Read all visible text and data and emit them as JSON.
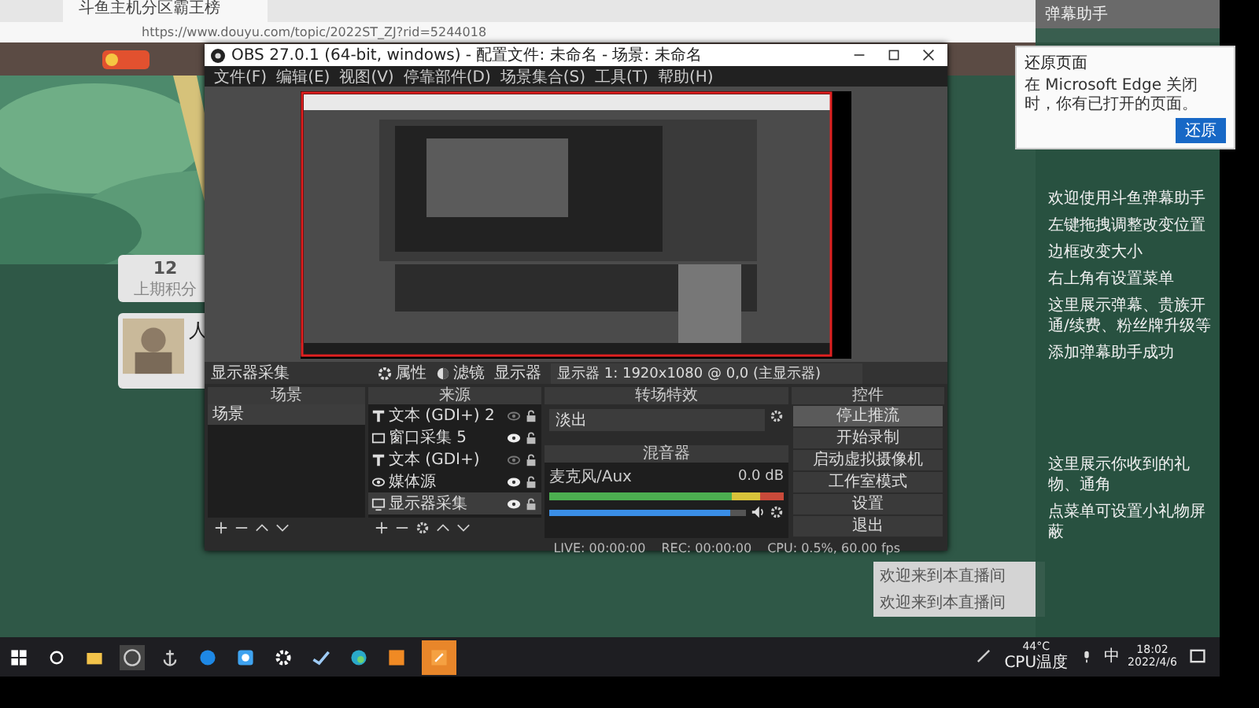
{
  "browser": {
    "tab_title": "斗鱼主机分区霸王榜",
    "url": "https://www.douyu.com/topic/2022ST_ZJ?rid=5244018"
  },
  "website": {
    "stat_value": "12",
    "stat_label": "上期积分",
    "card_title": "人"
  },
  "obs": {
    "title": "OBS 27.0.1 (64-bit, windows) - 配置文件: 未命名 - 场景: 未命名",
    "menu": [
      "文件(F)",
      "编辑(E)",
      "视图(V)",
      "停靠部件(D)",
      "场景集合(S)",
      "工具(T)",
      "帮助(H)"
    ],
    "toolbar": {
      "source_name": "显示器采集",
      "buttons": [
        {
          "label": "属性",
          "kind": "gear"
        },
        {
          "label": "滤镜",
          "kind": "filter"
        }
      ],
      "display_label": "显示器",
      "display_value": "显示器 1: 1920x1080 @ 0,0 (主显示器)"
    },
    "scenes": {
      "title": "场景",
      "items": [
        {
          "label": "场景",
          "selected": true
        }
      ]
    },
    "sources": {
      "title": "来源",
      "items": [
        {
          "label": "文本 (GDI+) 2",
          "kind": "text",
          "visible": false,
          "selected": false
        },
        {
          "label": "窗口采集 5",
          "kind": "window",
          "visible": true,
          "selected": false
        },
        {
          "label": "文本 (GDI+)",
          "kind": "text",
          "visible": false,
          "selected": false
        },
        {
          "label": "媒体源",
          "kind": "media",
          "visible": true,
          "selected": false
        },
        {
          "label": "显示器采集",
          "kind": "monitor",
          "visible": true,
          "selected": true
        }
      ]
    },
    "transitions": {
      "title": "转场特效",
      "value": "淡出"
    },
    "mixer": {
      "title": "混音器",
      "channel": {
        "name": "麦克风/Aux",
        "reading": "0.0 dB",
        "level": 0.92
      }
    },
    "controls": {
      "title": "控件",
      "buttons": [
        {
          "label": "停止推流",
          "selected": true
        },
        {
          "label": "开始录制",
          "selected": false
        },
        {
          "label": "启动虚拟摄像机",
          "selected": false
        },
        {
          "label": "工作室模式",
          "selected": false
        },
        {
          "label": "设置",
          "selected": false
        },
        {
          "label": "退出",
          "selected": false
        }
      ]
    },
    "status": [
      "LIVE: 00:00:00",
      "REC: 00:00:00",
      "CPU: 0.5%, 60.00 fps"
    ]
  },
  "edge_popup": {
    "title": "还原页面",
    "message": "在 Microsoft Edge 关闭时，你有已打开的页面。",
    "button": "还原"
  },
  "danmaku": {
    "title": "弹幕助手",
    "lines": [
      "欢迎使用斗鱼弹幕助手",
      "左键拖拽调整改变位置",
      "边框改变大小",
      "右上角有设置菜单",
      "这里展示弹幕、贵族开通/续费、粉丝牌升级等",
      "添加弹幕助手成功"
    ],
    "lines2": [
      "这里展示你收到的礼物、通角",
      "点菜单可设置小礼物屏蔽"
    ]
  },
  "chat": {
    "messages": [
      "欢迎来到本直播间",
      "欢迎来到本直播间"
    ]
  },
  "taskbar": {
    "cpu_temp": "44°C",
    "cpu_label": "CPU温度",
    "ime": "中",
    "time": "18:02",
    "date": "2022/4/6"
  }
}
